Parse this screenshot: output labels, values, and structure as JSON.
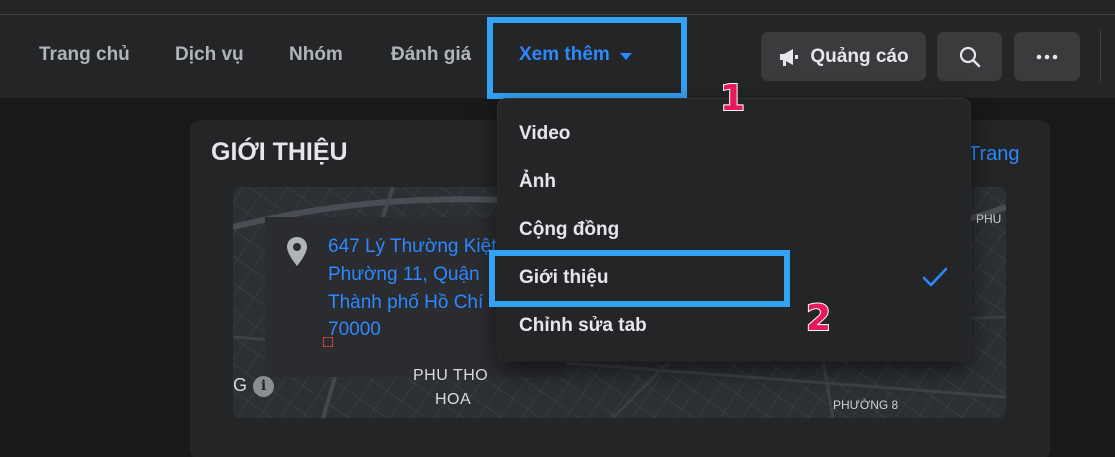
{
  "nav": {
    "tabs": [
      "Trang chủ",
      "Dịch vụ",
      "Nhóm",
      "Đánh giá"
    ],
    "more_label": "Xem thêm",
    "ads_label": "Quảng cáo"
  },
  "steps": {
    "first": "1",
    "second": "2"
  },
  "dropdown": {
    "items": [
      "Video",
      "Ảnh",
      "Cộng đồng",
      "Giới thiệu",
      "Chỉnh sửa tab"
    ],
    "selected_index": 3
  },
  "about": {
    "title": "GIỚI THIỆU",
    "link_text": "Trang",
    "address_lines": [
      "647 Lý Thường Kiệt",
      "Phường 11, Quận",
      "Thành phố Hồ Chí",
      "70000"
    ]
  },
  "map": {
    "labels": [
      "PHU THO",
      "HOA",
      "PHƯỜNG 8",
      "PHU",
      "G"
    ]
  },
  "colors": {
    "accent": "#2d88ff",
    "highlight_box": "#35a3f5",
    "step_number": "#e8195a",
    "surface": "#242526",
    "background": "#18191a"
  }
}
